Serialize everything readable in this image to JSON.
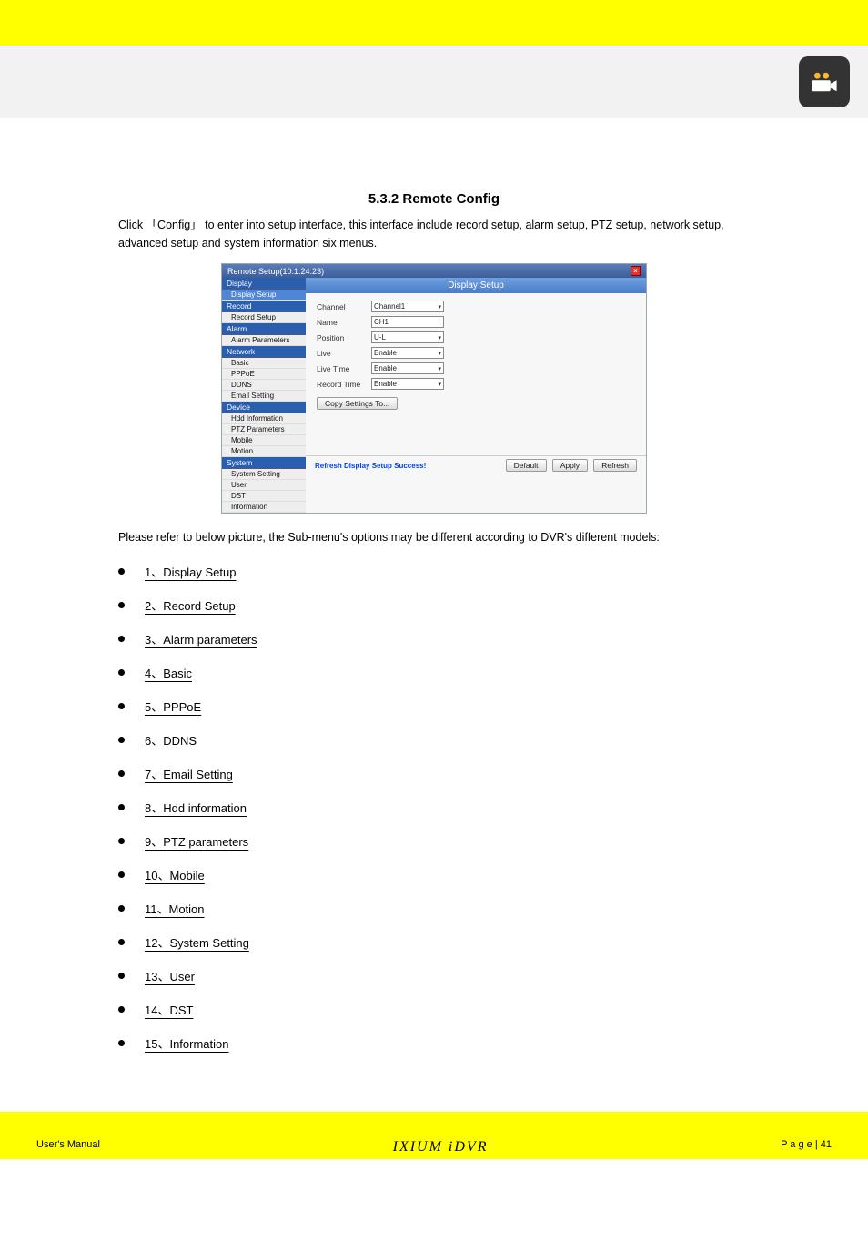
{
  "header": {
    "logo_alt": "camera-icon"
  },
  "section": {
    "title": "5.3.2 Remote Config",
    "intro": "Click 「Config」 to enter into setup interface, this interface include record setup, alarm setup, PTZ setup, network setup, advanced setup and system information six menus.",
    "screenshot": {
      "window_title": "Remote Setup(10.1.24.23)",
      "banner": "Display Setup",
      "nav": {
        "display": {
          "cat": "Display",
          "items": [
            "Display Setup"
          ]
        },
        "record": {
          "cat": "Record",
          "items": [
            "Record Setup"
          ]
        },
        "alarm": {
          "cat": "Alarm",
          "items": [
            "Alarm Parameters"
          ]
        },
        "network": {
          "cat": "Network",
          "items": [
            "Basic",
            "PPPoE",
            "DDNS",
            "Email Setting"
          ]
        },
        "device": {
          "cat": "Device",
          "items": [
            "Hdd Information",
            "PTZ Parameters",
            "Mobile",
            "Motion"
          ]
        },
        "system": {
          "cat": "System",
          "items": [
            "System Setting",
            "User",
            "DST",
            "Information"
          ]
        }
      },
      "fields": {
        "channel_label": "Channel",
        "channel_value": "Channel1",
        "name_label": "Name",
        "name_value": "CH1",
        "position_label": "Position",
        "position_value": "U-L",
        "live_label": "Live",
        "live_value": "Enable",
        "livetime_label": "Live Time",
        "livetime_value": "Enable",
        "recordtime_label": "Record Time",
        "recordtime_value": "Enable"
      },
      "copy_btn": "Copy Settings To...",
      "footer_status": "Refresh Display Setup Success!",
      "footer_btns": {
        "default": "Default",
        "apply": "Apply",
        "refresh": "Refresh"
      }
    },
    "sub_note": "Please refer to below picture, the Sub-menu's options may be different according to DVR's different models:"
  },
  "outline": [
    "1、Display Setup",
    "2、Record Setup",
    "3、Alarm parameters",
    "4、Basic",
    "5、PPPoE",
    "6、DDNS",
    "7、Email Setting",
    "8、Hdd information",
    "9、PTZ parameters",
    "10、Mobile",
    "11、Motion",
    "12、System Setting",
    "13、User",
    "14、DST",
    "15、Information"
  ],
  "footer": {
    "left": "User's Manual",
    "model": "IXIUM  iDVR",
    "right_prefix": "P a g e",
    "right_num": "| 41"
  }
}
